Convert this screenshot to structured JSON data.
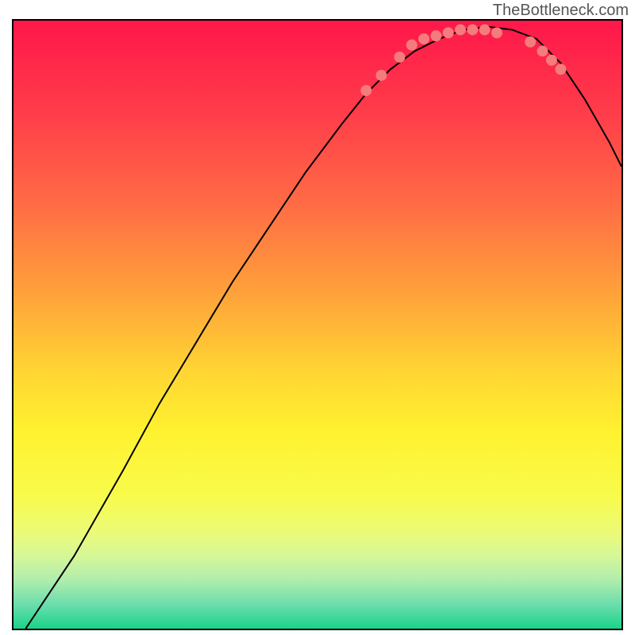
{
  "watermark": "TheBottleneck.com",
  "chart_data": {
    "type": "line",
    "title": "",
    "xlabel": "",
    "ylabel": "",
    "xlim": [
      0,
      100
    ],
    "ylim": [
      0,
      100
    ],
    "gradient": {
      "stops": [
        {
          "offset": 0,
          "color": "#ff174a"
        },
        {
          "offset": 15,
          "color": "#ff3c4a"
        },
        {
          "offset": 30,
          "color": "#ff6b45"
        },
        {
          "offset": 45,
          "color": "#ffa23a"
        },
        {
          "offset": 58,
          "color": "#ffd633"
        },
        {
          "offset": 68,
          "color": "#fff230"
        },
        {
          "offset": 78,
          "color": "#f8fb4a"
        },
        {
          "offset": 84,
          "color": "#ecfb76"
        },
        {
          "offset": 88,
          "color": "#d6f798"
        },
        {
          "offset": 92,
          "color": "#b0edac"
        },
        {
          "offset": 96,
          "color": "#6cddad"
        },
        {
          "offset": 100,
          "color": "#1ad389"
        }
      ]
    },
    "curve": [
      {
        "x": 2,
        "y": 0
      },
      {
        "x": 10,
        "y": 12
      },
      {
        "x": 18,
        "y": 26
      },
      {
        "x": 24,
        "y": 37
      },
      {
        "x": 30,
        "y": 47
      },
      {
        "x": 36,
        "y": 57
      },
      {
        "x": 42,
        "y": 66
      },
      {
        "x": 48,
        "y": 75
      },
      {
        "x": 54,
        "y": 83
      },
      {
        "x": 58,
        "y": 88
      },
      {
        "x": 62,
        "y": 92
      },
      {
        "x": 66,
        "y": 95
      },
      {
        "x": 70,
        "y": 97
      },
      {
        "x": 74,
        "y": 98.5
      },
      {
        "x": 78,
        "y": 99
      },
      {
        "x": 82,
        "y": 98.5
      },
      {
        "x": 86,
        "y": 97
      },
      {
        "x": 90,
        "y": 93
      },
      {
        "x": 94,
        "y": 87
      },
      {
        "x": 98,
        "y": 80
      },
      {
        "x": 100,
        "y": 76
      }
    ],
    "dots": [
      {
        "x": 58,
        "y": 88.5
      },
      {
        "x": 60.5,
        "y": 91
      },
      {
        "x": 63.5,
        "y": 94
      },
      {
        "x": 65.5,
        "y": 96
      },
      {
        "x": 67.5,
        "y": 97
      },
      {
        "x": 69.5,
        "y": 97.5
      },
      {
        "x": 71.5,
        "y": 98
      },
      {
        "x": 73.5,
        "y": 98.5
      },
      {
        "x": 75.5,
        "y": 98.5
      },
      {
        "x": 77.5,
        "y": 98.5
      },
      {
        "x": 79.5,
        "y": 98
      },
      {
        "x": 85,
        "y": 96.5
      },
      {
        "x": 87,
        "y": 95
      },
      {
        "x": 88.5,
        "y": 93.5
      },
      {
        "x": 90,
        "y": 92
      }
    ],
    "dot_color": "#f47c7c",
    "dot_radius": 7
  }
}
